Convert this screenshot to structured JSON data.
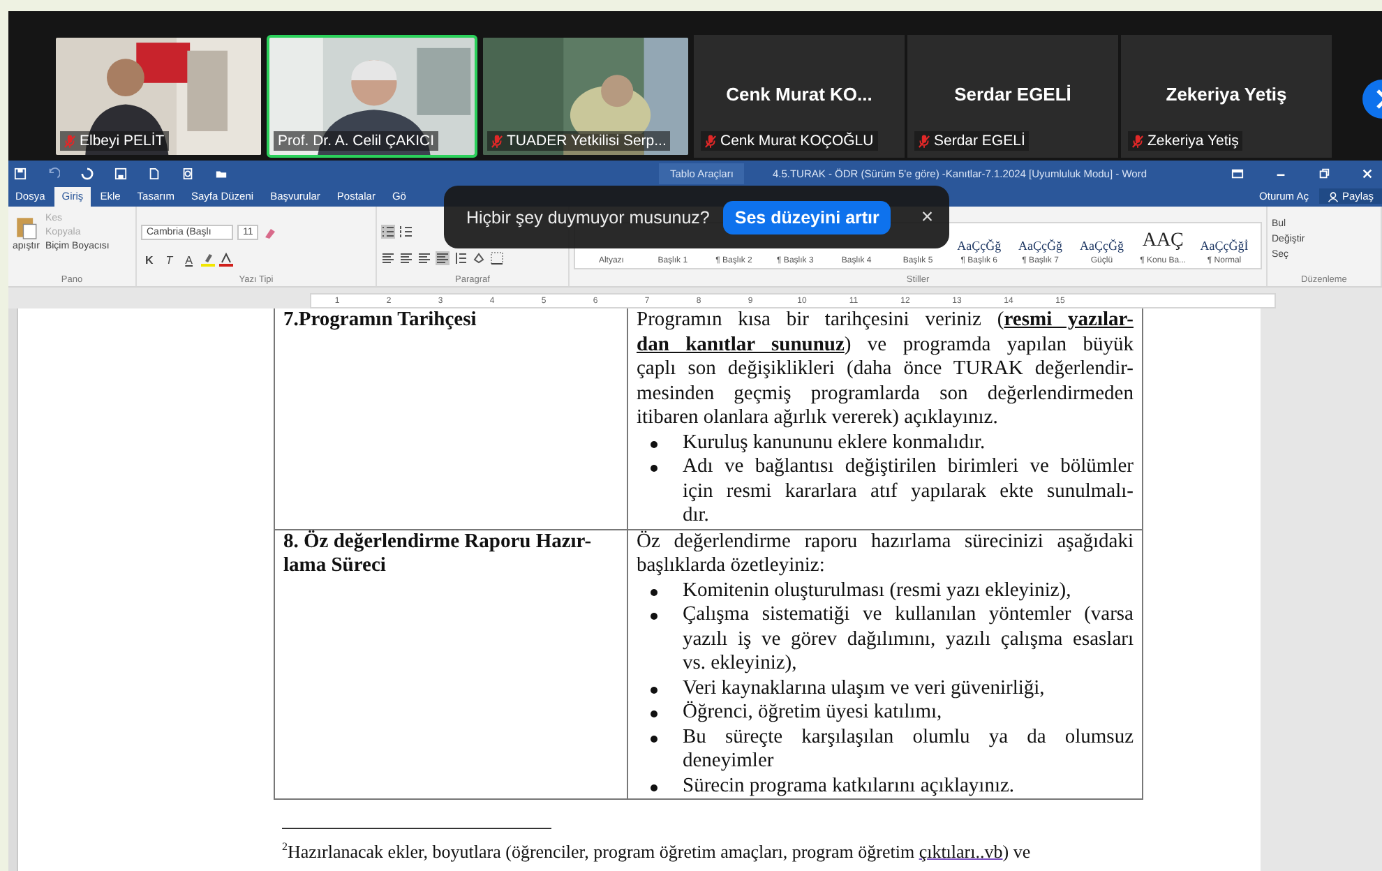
{
  "meeting": {
    "tiles": [
      {
        "kind": "video",
        "name": "Elbeyi PELİT",
        "muted": true,
        "speaking": false
      },
      {
        "kind": "video",
        "name": "Prof. Dr. A. Celil ÇAKICI",
        "muted": false,
        "speaking": true
      },
      {
        "kind": "video",
        "name": "TUADER Yetkilisi Serp...",
        "muted": true,
        "speaking": false
      },
      {
        "kind": "avatar",
        "title": "Cenk Murat KO...",
        "name": "Cenk Murat KOÇOĞLU",
        "muted": true,
        "speaking": false
      },
      {
        "kind": "avatar",
        "title": "Serdar EGELİ",
        "name": "Serdar EGELİ",
        "muted": true,
        "speaking": false
      },
      {
        "kind": "avatar",
        "title": "Zekeriya Yetiş",
        "name": "Zekeriya Yetiş",
        "muted": true,
        "speaking": false
      }
    ]
  },
  "word": {
    "context_tab": "Tablo Araçları",
    "title": "4.5.TURAK - ÖDR (Sürüm 5'e göre) -Kanıtlar-7.1.2024 [Uyumluluk Modu] - Word",
    "tabs": [
      {
        "label": "Dosya",
        "selected": false
      },
      {
        "label": "Giriş",
        "selected": true
      },
      {
        "label": "Ekle",
        "selected": false
      },
      {
        "label": "Tasarım",
        "selected": false
      },
      {
        "label": "Sayfa Düzeni",
        "selected": false
      },
      {
        "label": "Başvurular",
        "selected": false
      },
      {
        "label": "Postalar",
        "selected": false
      },
      {
        "label": "Gö",
        "selected": false
      }
    ],
    "sign_in": "Oturum Aç",
    "share": "Paylaş",
    "ribbon": {
      "clipboard": {
        "paste": "apıştır",
        "cut": "Kes",
        "copy": "Kopyala",
        "painter": "Biçim Boyacısı",
        "label": "Pano"
      },
      "font": {
        "name": "Cambria (Başlı",
        "size": "11",
        "bold": "K",
        "italic": "T",
        "underline": "A",
        "label": "Yazı Tipi"
      },
      "paragraph": {
        "label": "Paragraf"
      },
      "styles": {
        "label": "Stiller",
        "items": [
          {
            "label": "Altyazı"
          },
          {
            "label": "Başlık 1"
          },
          {
            "label": "¶ Başlık 2"
          },
          {
            "label": "¶ Başlık 3"
          },
          {
            "label": "Başlık 4"
          },
          {
            "label": "Başlık 5"
          },
          {
            "sample": "AaÇçĞğ",
            "label": "¶ Başlık 6"
          },
          {
            "sample": "AaÇçĞğ",
            "label": "¶ Başlık 7"
          },
          {
            "sample": "AaÇçĞğ",
            "label": "Güçlü"
          },
          {
            "sample": "AAÇ",
            "label": "¶ Konu Ba..."
          },
          {
            "sample": "AaÇçĞğİ",
            "label": "¶ Normal"
          }
        ]
      },
      "editing": {
        "find": "Bul",
        "replace": "Değiştir",
        "select": "Seç",
        "label": "Düzenleme"
      }
    },
    "ruler_numbers": [
      "1",
      "2",
      "3",
      "4",
      "5",
      "6",
      "7",
      "8",
      "9",
      "10",
      "11",
      "12",
      "13",
      "14",
      "15"
    ]
  },
  "notification": {
    "message": "Hiçbir şey duymuyor musunuz?",
    "action": "Ses düzeyini artır",
    "close": "×"
  },
  "document": {
    "rows": [
      {
        "heading": [
          "7.Programın Tarihçesi"
        ],
        "paragraph": [
          "Programın kısa bir tarihçesini veriniz (**resmi yazılar-**",
          "**dan kanıtlar sununuz**) ve programda yapılan büyük",
          "çaplı son değişiklikleri (daha önce TURAK değerlendir-",
          "mesinden geçmiş programlarda son değerlendirmeden",
          "itibaren olanlara ağırlık vererek) açıklayınız."
        ],
        "bullets": [
          [
            "Kuruluş kanununu eklere konmalıdır."
          ],
          [
            "Adı ve bağlantısı değiştirilen birimleri ve bölümler",
            "için resmi kararlara atıf yapılarak ekte sunulmalı-",
            "dır."
          ]
        ]
      },
      {
        "heading": [
          "8. Öz değerlendirme Raporu Hazır-",
          "lama Süreci"
        ],
        "paragraph": [
          "Öz değerlendirme raporu hazırlama sürecinizi aşağıdaki",
          "başlıklarda özetleyiniz:"
        ],
        "bullets": [
          [
            "Komitenin oluşturulması (resmi yazı ekleyiniz),"
          ],
          [
            "Çalışma sistematiği ve kullanılan yöntemler (varsa",
            "yazılı iş ve görev dağılımını, yazılı çalışma esasları",
            "vs. ekleyiniz),"
          ],
          [
            "Veri kaynaklarına ulaşım ve veri güvenirliği,"
          ],
          [
            "Öğrenci, öğretim üyesi katılımı,"
          ],
          [
            "Bu süreçte karşılaşılan olumlu ya da olumsuz",
            "deneyimler"
          ],
          [
            "Sürecin programa katkılarını açıklayınız."
          ]
        ]
      }
    ],
    "footnote": {
      "mark": "2",
      "text": "Hazırlanacak ekler, boyutlara (öğrenciler, program öğretim amaçları, program öğretim ",
      "link": "çıktıları..vb",
      "after": ") ve"
    }
  }
}
